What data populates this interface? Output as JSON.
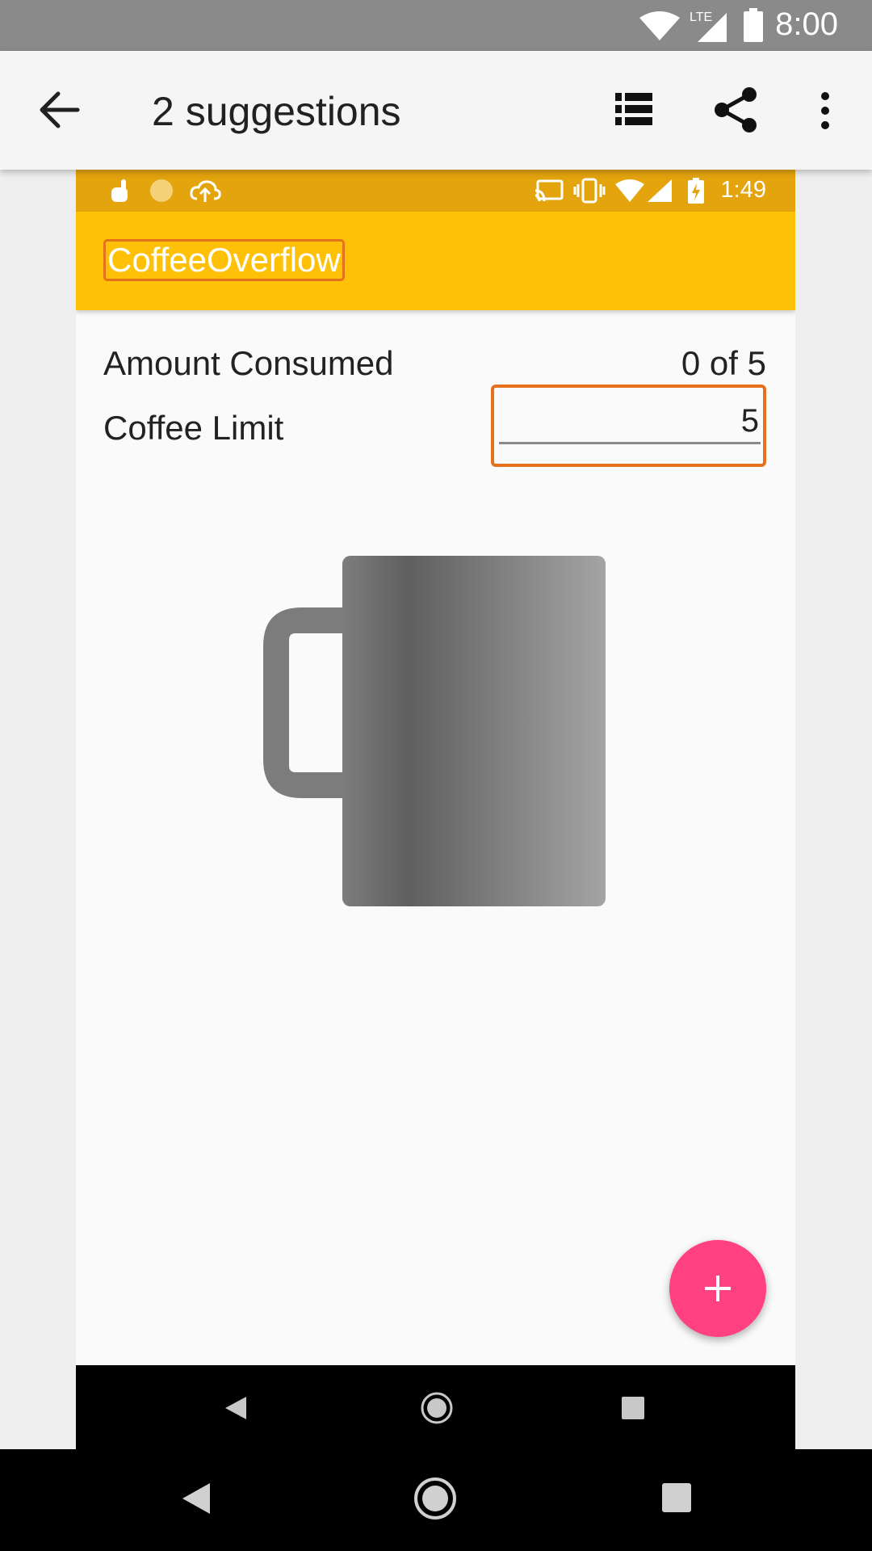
{
  "outer_status": {
    "time": "8:00",
    "network_label": "LTE"
  },
  "outer_appbar": {
    "title": "2 suggestions"
  },
  "inner_status": {
    "time": "1:49"
  },
  "app": {
    "title": "CoffeeOverflow",
    "amount_label": "Amount Consumed",
    "amount_value": "0 of 5",
    "limit_label": "Coffee Limit",
    "limit_value": "5"
  },
  "fab": {
    "symbol": "+"
  },
  "colors": {
    "app_bar": "#fec107",
    "inner_status": "#e4a40d",
    "highlight": "#e5711d",
    "fab": "#ff4081"
  }
}
